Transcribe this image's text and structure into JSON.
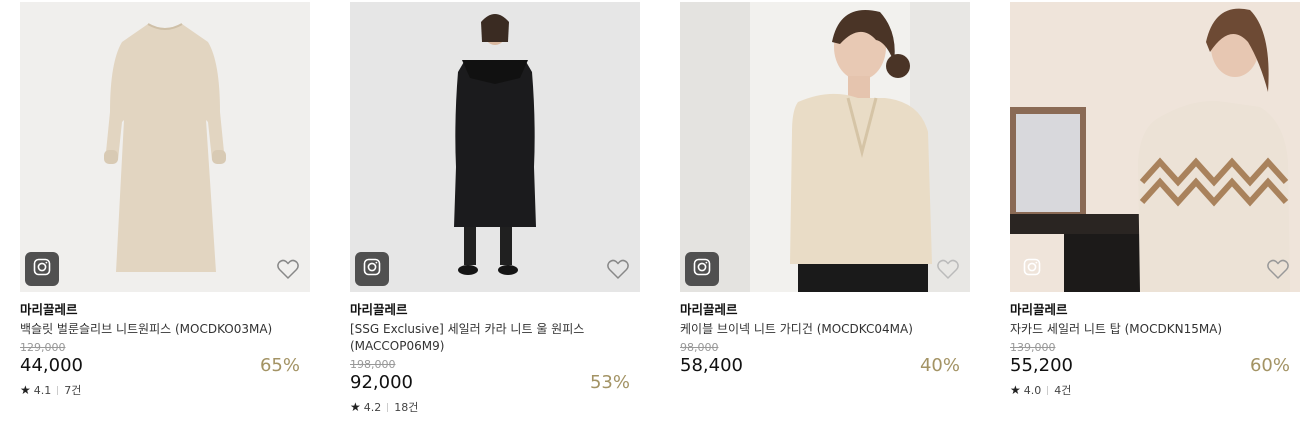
{
  "products": [
    {
      "brand": "마리끌레르",
      "name": "백슬릿 벌룬슬리브 니트원피스 (MOCDKO03MA)",
      "original_price": "129,000",
      "price": "44,000",
      "discount": "65%",
      "rating": "4.1",
      "reviews": "7건",
      "icon": "instagram-icon"
    },
    {
      "brand": "마리끌레르",
      "name": "[SSG Exclusive] 세일러 카라 니트 울 원피스 (MACCOP06M9)",
      "original_price": "198,000",
      "price": "92,000",
      "discount": "53%",
      "rating": "4.2",
      "reviews": "18건",
      "icon": "instagram-icon"
    },
    {
      "brand": "마리끌레르",
      "name": "케이블 브이넥 니트 가디건 (MOCDKC04MA)",
      "original_price": "98,000",
      "price": "58,400",
      "discount": "40%",
      "icon": "instagram-icon"
    },
    {
      "brand": "마리끌레르",
      "name": "자카드 세일러 니트 탑 (MOCDKN15MA)",
      "original_price": "139,000",
      "price": "55,200",
      "discount": "60%",
      "rating": "4.0",
      "reviews": "4건",
      "icon": "instagram-icon"
    }
  ],
  "colors": {
    "discount": "#a39364",
    "instagram_badge": "#505050"
  }
}
